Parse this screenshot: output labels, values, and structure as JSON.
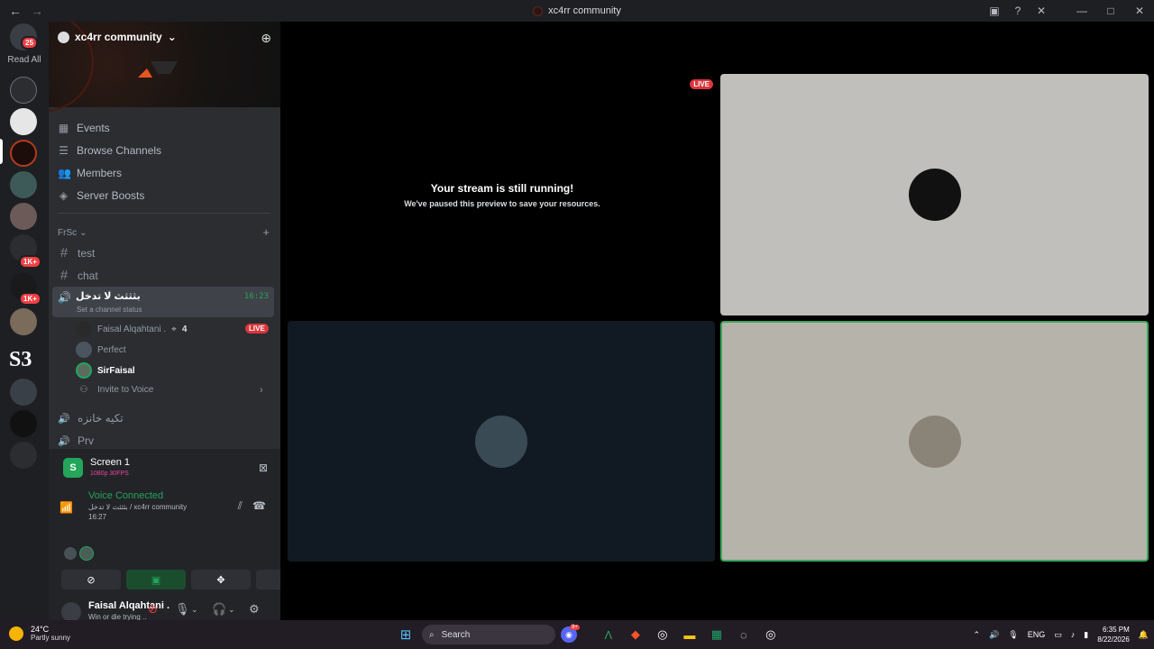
{
  "window": {
    "title": "xc4rr community",
    "back_glyph": "←",
    "forward_glyph": "→",
    "minimize_glyph": "—",
    "maximize_glyph": "□",
    "close_glyph": "✕"
  },
  "rail": {
    "unread_badge": "25",
    "read_all": "Read All",
    "badge_1k_a": "1K+",
    "badge_1k_b": "1K+",
    "s3": "S3"
  },
  "server": {
    "name": "xc4rr community",
    "chevron": "⌄",
    "menu": [
      {
        "label": "Events",
        "icon": "calendar-icon",
        "glyph": "▦"
      },
      {
        "label": "Browse Channels",
        "icon": "browse-icon",
        "glyph": "☰"
      },
      {
        "label": "Members",
        "icon": "members-icon",
        "glyph": "👥"
      },
      {
        "label": "Server Boosts",
        "icon": "boost-icon",
        "glyph": "◈"
      }
    ],
    "category": "FrSc",
    "category_add": "+",
    "channels": [
      {
        "label": "test"
      },
      {
        "label": "chat"
      }
    ],
    "voice_channel": {
      "name": "بثثثث لا تدخل",
      "status": "Set a channel status",
      "timer": "16:23"
    },
    "voice_users": [
      {
        "name": "Faisal Alqahtani .",
        "extra": "4",
        "live": "LIVE"
      },
      {
        "name": "Perfect"
      },
      {
        "name": "SirFaisal"
      }
    ],
    "invite_to_voice": "Invite to Voice",
    "more_channels": [
      {
        "label": "تكيه خانزه"
      },
      {
        "label": "Prv"
      }
    ]
  },
  "panel": {
    "screen_title": "Screen 1",
    "screen_quality": "1080p 30FPS",
    "screen_letter": "S",
    "voice_status": "Voice Connected",
    "voice_channel": "بثثثث لا تدخل / xc4rr community",
    "voice_time": "16:27",
    "user": {
      "display_name": "Faisal Alqahtani .",
      "status": "Win or die trying .."
    }
  },
  "stage": {
    "live": "LIVE",
    "message": "Your stream is still running!",
    "sub": "We've paused this preview to save your resources.",
    "tiles": [
      {
        "name": "top-right",
        "bg": "#c0bfbb"
      },
      {
        "name": "bottom-left",
        "bg": "#111a22"
      },
      {
        "name": "bottom-right",
        "bg": "#b6b4aa"
      }
    ]
  },
  "taskbar": {
    "temp": "24°C",
    "weather": "Partly sunny",
    "search": "Search",
    "lang": "ENG",
    "time": "6:35 PM",
    "date": "8/22/2026",
    "discord_badge": "9+"
  },
  "colors": {
    "accent_green": "#23a55a",
    "live_red": "#da373c",
    "speaking_border": "#3ba55c"
  }
}
